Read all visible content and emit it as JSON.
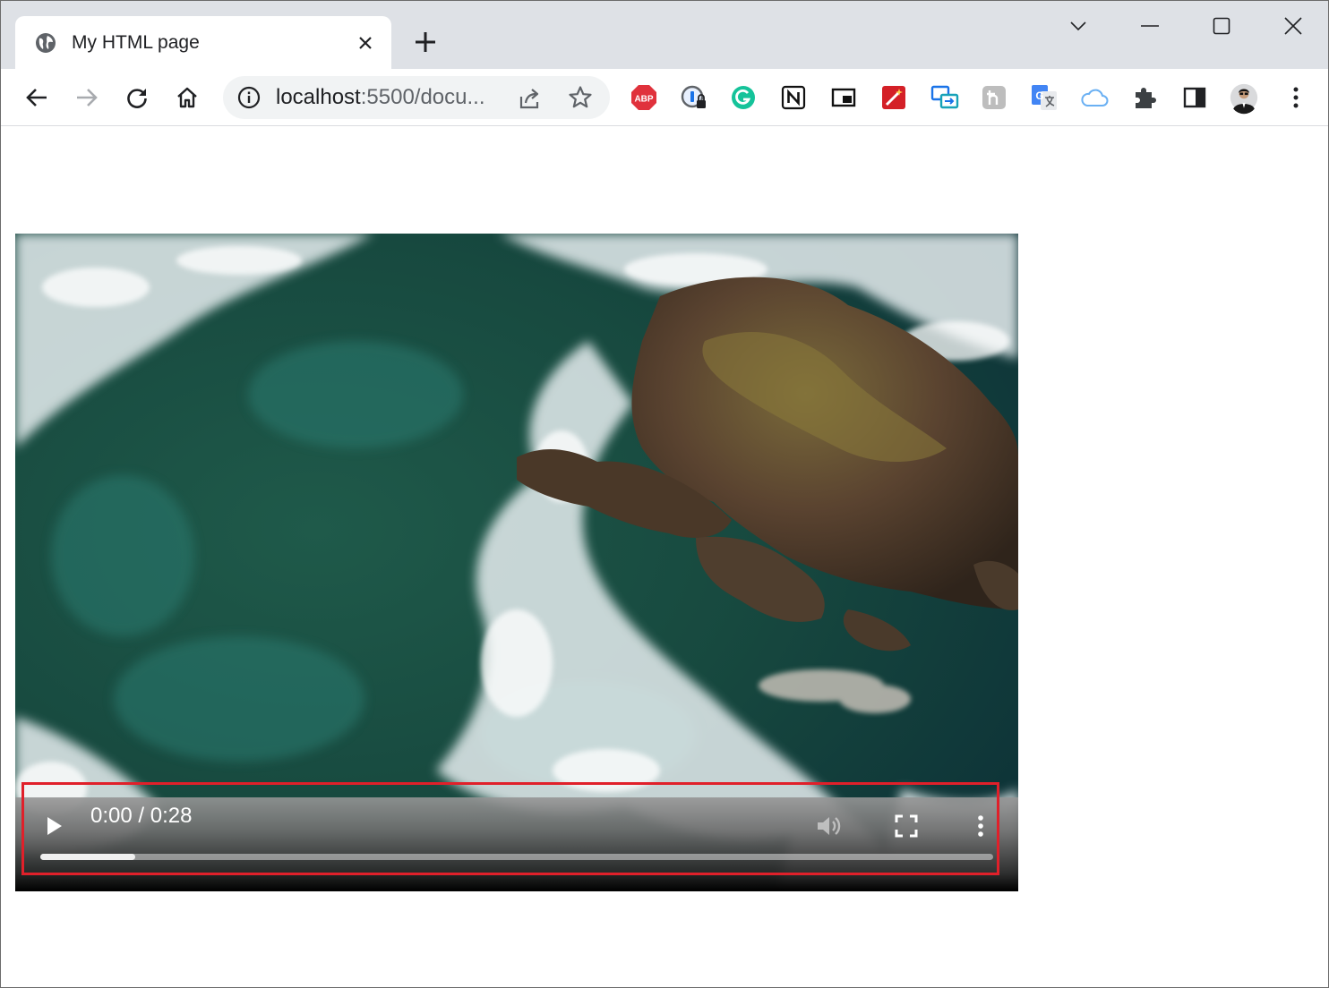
{
  "browser": {
    "tab": {
      "title": "My HTML page",
      "favicon": "globe-icon"
    },
    "omnibox": {
      "url_host": "localhost",
      "url_rest": ":5500/docu..."
    },
    "extensions": [
      "adblock-plus-icon",
      "password-manager-icon",
      "grammarly-icon",
      "notion-icon",
      "picture-in-picture-icon",
      "magic-wand-icon",
      "screen-share-icon",
      "hyphen-icon",
      "google-translate-icon",
      "cloud-icon",
      "puzzle-piece-icon",
      "side-panel-icon",
      "profile-avatar"
    ],
    "adblock_label": "ABP",
    "accent_color": "#1a73e8"
  },
  "video": {
    "current_time": "0:00",
    "duration": "0:28",
    "time_display": "0:00 / 0:28",
    "buffered_fraction": 0.1,
    "highlight_color": "#e0202a"
  }
}
